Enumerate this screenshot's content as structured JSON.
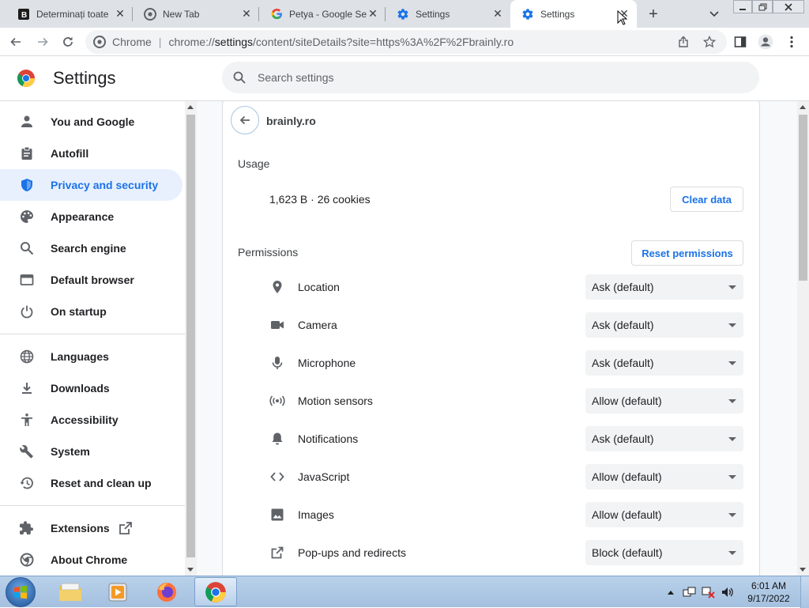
{
  "tabs": [
    {
      "title": "Determinați toate",
      "close": "✕"
    },
    {
      "title": "New Tab",
      "close": "✕"
    },
    {
      "title": "Petya - Google Se",
      "close": "✕"
    },
    {
      "title": "Settings",
      "close": "✕"
    },
    {
      "title": "Settings",
      "close": "✕",
      "active": true
    }
  ],
  "toolbar": {
    "new_tab": "+",
    "omnibox_chip": "Chrome",
    "divider": "|",
    "url_prefix": "chrome://",
    "url_host": "settings",
    "url_rest": "/content/siteDetails?site=https%3A%2F%2Fbrainly.ro"
  },
  "header": {
    "title": "Settings",
    "search_placeholder": "Search settings"
  },
  "sidebar": {
    "items": [
      {
        "label": "You and Google",
        "icon": "person-icon"
      },
      {
        "label": "Autofill",
        "icon": "clipboard-icon"
      },
      {
        "label": "Privacy and security",
        "icon": "shield-icon",
        "selected": true
      },
      {
        "label": "Appearance",
        "icon": "palette-icon"
      },
      {
        "label": "Search engine",
        "icon": "search-icon"
      },
      {
        "label": "Default browser",
        "icon": "browser-window-icon"
      },
      {
        "label": "On startup",
        "icon": "power-icon"
      },
      {
        "label": "Languages",
        "icon": "globe-icon"
      },
      {
        "label": "Downloads",
        "icon": "download-icon"
      },
      {
        "label": "Accessibility",
        "icon": "accessibility-icon"
      },
      {
        "label": "System",
        "icon": "wrench-icon"
      },
      {
        "label": "Reset and clean up",
        "icon": "history-icon"
      },
      {
        "label": "Extensions",
        "icon": "puzzle-icon"
      },
      {
        "label": "About Chrome",
        "icon": "chrome-icon"
      }
    ]
  },
  "site": {
    "name": "brainly.ro",
    "usage_title": "Usage",
    "usage_text": "1,623 B · 26 cookies",
    "clear_data": "Clear data",
    "permissions_title": "Permissions",
    "reset_permissions": "Reset permissions",
    "permissions": [
      {
        "label": "Location",
        "value": "Ask (default)",
        "icon": "location-pin-icon"
      },
      {
        "label": "Camera",
        "value": "Ask (default)",
        "icon": "camera-icon"
      },
      {
        "label": "Microphone",
        "value": "Ask (default)",
        "icon": "microphone-icon"
      },
      {
        "label": "Motion sensors",
        "value": "Allow (default)",
        "icon": "motion-sensor-icon"
      },
      {
        "label": "Notifications",
        "value": "Ask (default)",
        "icon": "bell-icon"
      },
      {
        "label": "JavaScript",
        "value": "Allow (default)",
        "icon": "code-icon"
      },
      {
        "label": "Images",
        "value": "Allow (default)",
        "icon": "image-icon"
      },
      {
        "label": "Pop-ups and redirects",
        "value": "Block (default)",
        "icon": "open-in-new-icon"
      }
    ]
  },
  "taskbar": {
    "time": "6:01 AM",
    "date": "9/17/2022"
  },
  "colors": {
    "accent": "#1a73e8",
    "selected_bg": "#e8f0fe",
    "tabstrip": "#dee1e6",
    "content_bg": "#f8f9fa"
  }
}
